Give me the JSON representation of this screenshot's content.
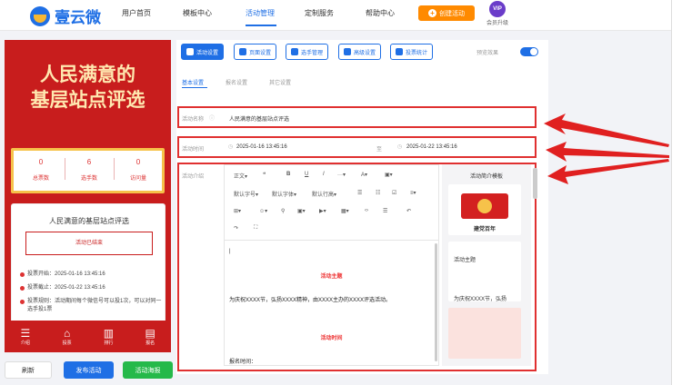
{
  "brand": "壹云微",
  "nav": [
    "用户首页",
    "模板中心",
    "活动管理",
    "定制服务",
    "帮助中心"
  ],
  "create_btn": "创建活动",
  "vip": {
    "badge": "VIP",
    "label": "会员升级"
  },
  "preview": {
    "title_line1": "人民满意的",
    "title_line2": "基层站点评选",
    "stats": [
      {
        "num": "0",
        "label": "总票数"
      },
      {
        "num": "6",
        "label": "选手数"
      },
      {
        "num": "0",
        "label": "访问量"
      }
    ],
    "card_title": "人民满意的基层站点评选",
    "banner": "活动已结束",
    "info": [
      "投票开始：2025-01-16 13:45:16",
      "投票截止：2025-01-22 13:45:16",
      "投票规则：活动期间每个微信号可以投1次，可以对同一选手投1票"
    ],
    "tabs": [
      {
        "icon": "☰",
        "label": "介绍"
      },
      {
        "icon": "⌂",
        "label": "投票"
      },
      {
        "icon": "▥",
        "label": "排行"
      },
      {
        "icon": "▤",
        "label": "报名"
      }
    ]
  },
  "bottom": {
    "refresh": "刷新",
    "publish": "发布活动",
    "preview": "活动海报"
  },
  "toolbar": [
    "活动设置",
    "页面设置",
    "选手管理",
    "高级设置",
    "投票统计"
  ],
  "preview_effect": "预览效果",
  "subtabs": [
    "基本设置",
    "报名设置",
    "其它设置"
  ],
  "form": {
    "name_label": "活动名称",
    "name_value": "人民满意的基层站点评选",
    "time_label": "活动时间",
    "start": "2025-01-16 13:45:16",
    "end": "2025-01-22 13:45:16",
    "to": "至",
    "intro_label": "活动介绍"
  },
  "editor": {
    "row1": [
      "正文▾",
      "❝",
      "B",
      "U",
      "I",
      "···▾",
      "A▾",
      "▣▾"
    ],
    "row2": [
      "默认字号▾",
      "默认字体▾",
      "默认行高▾",
      "☰",
      "☷",
      "☑",
      "≡▾"
    ],
    "row3": [
      "⊞▾",
      "☺▾",
      "⚲",
      "▣▾",
      "▶▾",
      "▦▾",
      "‹›",
      "☰",
      "↶"
    ],
    "row4": [
      "↷",
      "⛶"
    ],
    "heading1": "活动主题",
    "para1": "为庆祝XXXX节，弘扬XXXX精神，由XXXX主办的XXXX评选活动。",
    "heading2": "活动时间",
    "para2": "报名时间："
  },
  "templates": {
    "title": "活动简介模板",
    "t1": "建党百年",
    "t2": "活动主题",
    "t3": "为庆祝XXXX节，弘扬"
  }
}
